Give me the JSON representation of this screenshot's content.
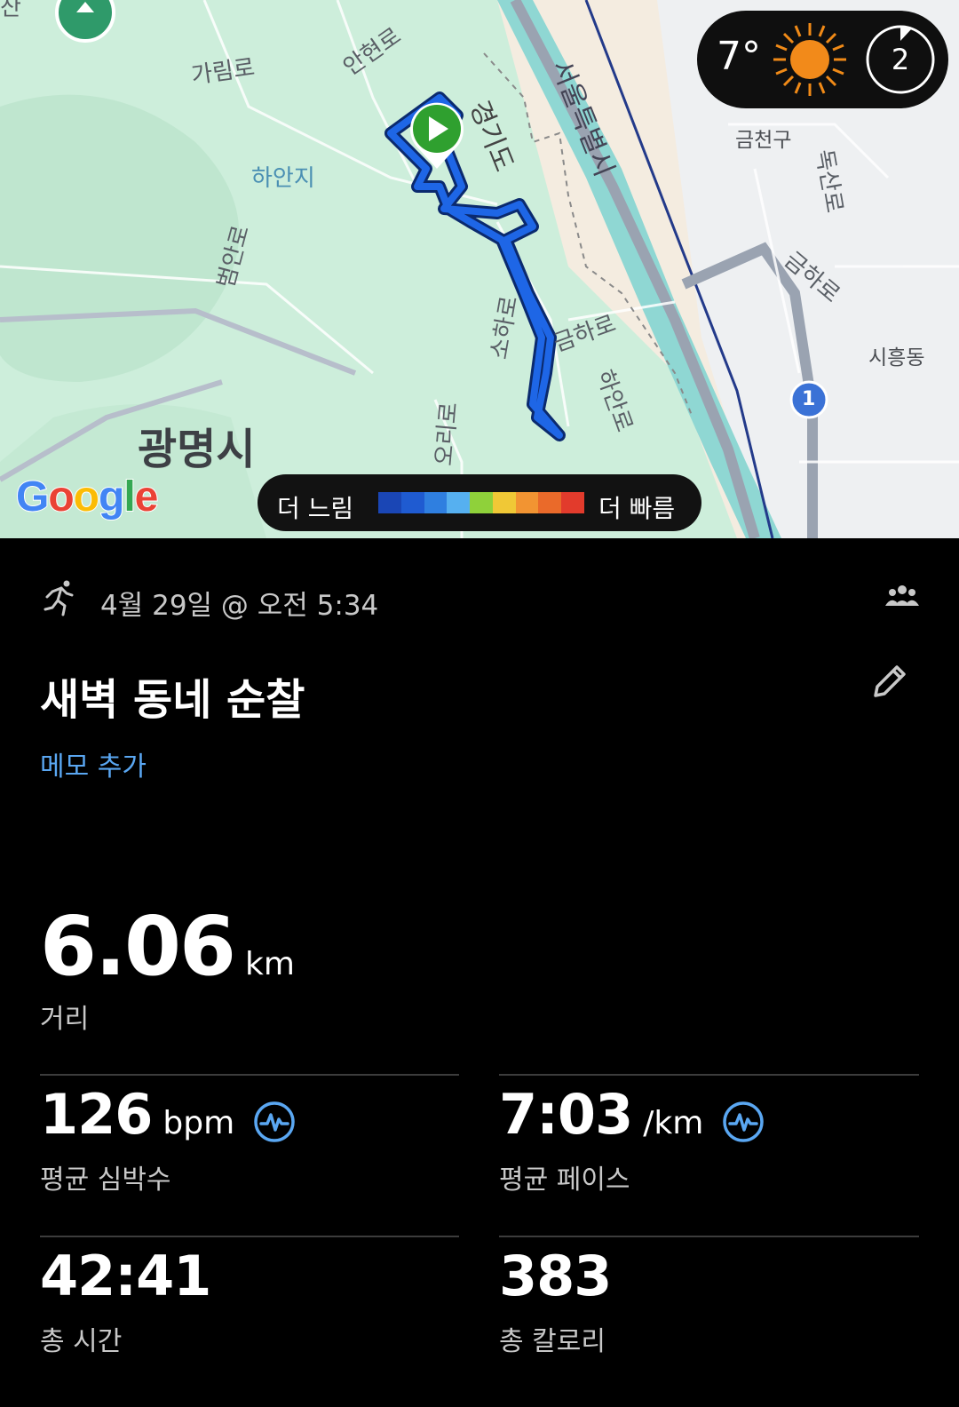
{
  "map": {
    "labels": {
      "garim_ro": "가림로",
      "anhyeon_ro": "안현로",
      "hanji": "하안지",
      "gyeonggi_do": "경기도",
      "seoul": "서울특별시",
      "geumcheon_gu": "금천구",
      "doksan_ro": "독산로",
      "geumha_ro_right": "금하로",
      "beoman_ro": "범안로",
      "soha_ro": "소하로",
      "geumha_ro_center": "금하로",
      "hanan_ro": "하안로",
      "siheung_dong": "시흥동",
      "ori_ro": "오리로",
      "gwangmyeong": "광명시",
      "route_badge": "1",
      "top_partial": "산"
    },
    "brand": "Google",
    "speed_legend": {
      "slow": "더 느림",
      "fast": "더 빠름",
      "colors": [
        "#1a46b5",
        "#1f5bd1",
        "#2f7fe0",
        "#56b0f0",
        "#8fd13a",
        "#f0c836",
        "#f29432",
        "#ea6a2a",
        "#e23b2c"
      ]
    }
  },
  "weather": {
    "temp": "7°",
    "icon": "sun-icon",
    "ring_value": "2"
  },
  "activity": {
    "icon": "running-icon",
    "datetime": "4월 29일 @ 오전 5:34",
    "title": "새벽 동네 순찰",
    "memo_link": "메모 추가"
  },
  "stats": {
    "distance": {
      "value": "6.06",
      "unit": "km",
      "label": "거리"
    },
    "heart_rate": {
      "value": "126",
      "unit": "bpm",
      "label": "평균 심박수"
    },
    "pace": {
      "value": "7:03",
      "unit": "/km",
      "label": "평균 페이스"
    },
    "duration": {
      "value": "42:41",
      "label": "총 시간"
    },
    "calories": {
      "value": "383",
      "label": "총 칼로리"
    }
  }
}
